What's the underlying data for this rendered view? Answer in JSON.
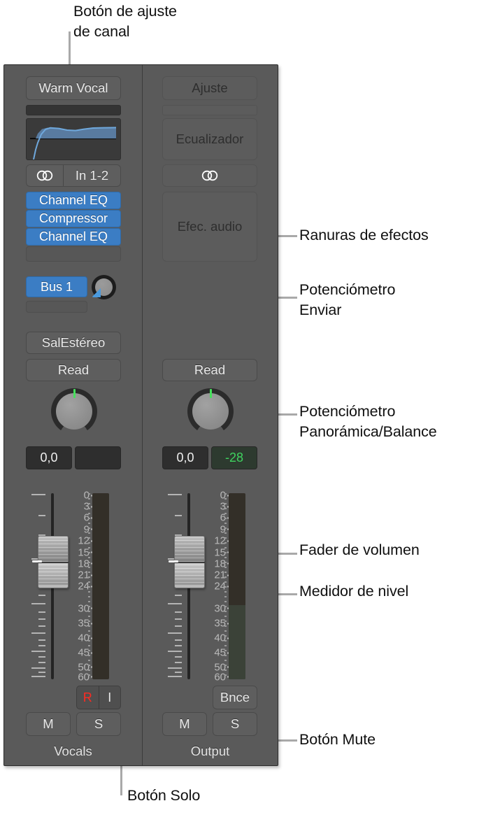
{
  "callouts": [
    {
      "id": "channel-setting",
      "text": "Botón de ajuste\nde canal"
    },
    {
      "id": "effect-slots",
      "text": "Ranuras de efectos"
    },
    {
      "id": "send-knob",
      "text": "Potenciómetro\nEnviar"
    },
    {
      "id": "pan-knob",
      "text": "Potenciómetro\nPanorámica/Balance"
    },
    {
      "id": "volume-fader",
      "text": "Fader de volumen"
    },
    {
      "id": "level-meter",
      "text": "Medidor de nivel"
    },
    {
      "id": "mute-button",
      "text": "Botón Mute"
    },
    {
      "id": "solo-button",
      "text": "Botón Solo"
    }
  ],
  "mixer": {
    "vocals": {
      "setting_button": "Warm Vocal",
      "input_label": "In 1-2",
      "stereo_icon": "stereo-pair-icon",
      "effect_slots": [
        "Channel EQ",
        "Compressor",
        "Channel EQ"
      ],
      "send": {
        "label": "Bus 1",
        "knob": "send-knob"
      },
      "output_label": "SalEstéreo",
      "automation_mode": "Read",
      "pan_value": "0,0",
      "gain_value": "",
      "scale_labels": [
        "0",
        "3",
        "6",
        "9",
        "12",
        "15",
        "18",
        "21",
        "24",
        "30",
        "35",
        "40",
        "45",
        "50",
        "60"
      ],
      "record_label": "R",
      "input_monitor_label": "I",
      "mute_label": "M",
      "solo_label": "S",
      "name": "Vocals",
      "meter_level_db": 0
    },
    "output": {
      "setting_button": "Ajuste",
      "eq_label": "Ecualizador",
      "stereo_icon": "stereo-pair-icon",
      "audio_effects_label": "Efec. audio",
      "automation_mode": "Read",
      "pan_value": "0,0",
      "gain_value": "-28",
      "scale_labels": [
        "0",
        "3",
        "6",
        "9",
        "12",
        "15",
        "18",
        "21",
        "24",
        "30",
        "35",
        "40",
        "45",
        "50",
        "60"
      ],
      "bounce_label": "Bnce",
      "mute_label": "M",
      "solo_label": "S",
      "name": "Output",
      "meter_level_db": 24
    }
  },
  "colors": {
    "panel": "#5a5a5a",
    "slot_blue": "#3b7dc4",
    "record_red": "#ff2a21",
    "gain_green": "#3fd35f",
    "pan_tick_green": "#46e05c",
    "eq_curve_blue": "#6fa8dc"
  }
}
